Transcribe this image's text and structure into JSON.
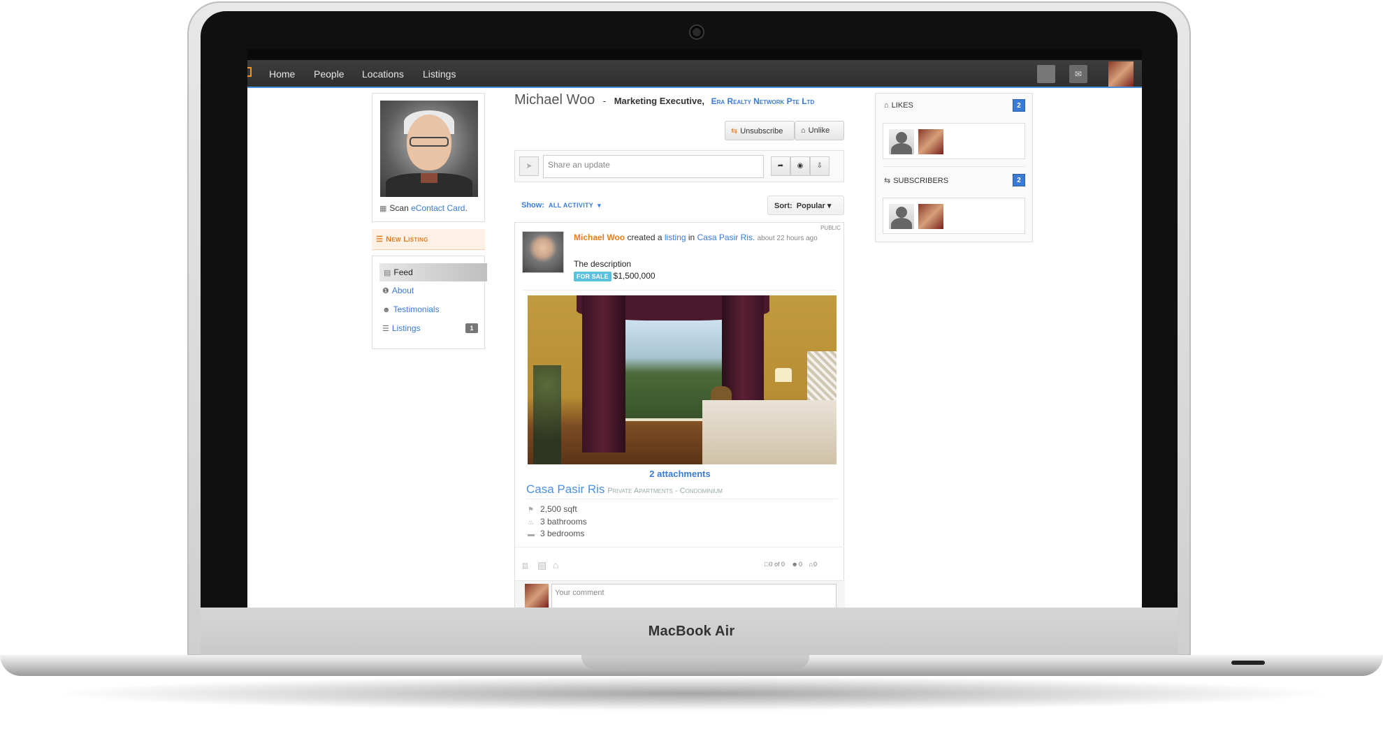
{
  "device": {
    "brand": "MacBook Air"
  },
  "nav": {
    "items": [
      {
        "label": "Home"
      },
      {
        "label": "People"
      },
      {
        "label": "Locations"
      },
      {
        "label": "Listings"
      }
    ],
    "mail_icon": "mail-icon"
  },
  "profile": {
    "name": "Michael Woo",
    "separator": "-",
    "role": "Marketing Executive,",
    "company": "Era Realty Network Pte Ltd",
    "scan_text": "Scan",
    "scan_link": "eContact Card",
    "scan_suffix": "."
  },
  "sidebar": {
    "new_listing": "New Listing",
    "items": [
      {
        "label": "Feed",
        "icon": "feed-icon"
      },
      {
        "label": "About",
        "icon": "info-icon"
      },
      {
        "label": "Testimonials",
        "icon": "users-icon"
      },
      {
        "label": "Listings",
        "icon": "list-icon",
        "count": "1"
      }
    ]
  },
  "actions": {
    "unsubscribe": "Unsubscribe",
    "unlike": "Unlike"
  },
  "share": {
    "placeholder": "Share an update"
  },
  "filters": {
    "show_label": "Show:",
    "show_value": "ALL ACTIVITY",
    "sort_label": "Sort:",
    "sort_value": "Popular"
  },
  "post": {
    "visibility": "PUBLIC",
    "author": "Michael Woo",
    "verb": "created a",
    "object": "listing",
    "prep": "in",
    "place": "Casa Pasir Ris.",
    "time": "about 22 hours ago",
    "description": "The description",
    "status": "FOR SALE",
    "price": "$1,500,000",
    "attachments": "2 attachments",
    "listing_title": "Casa Pasir Ris",
    "listing_subtitle": "Private Apartments - Condominium",
    "features": [
      {
        "text": "2,500 sqft",
        "icon": "area-icon"
      },
      {
        "text": "3 bathrooms",
        "icon": "bath-icon"
      },
      {
        "text": "3 bedrooms",
        "icon": "bed-icon"
      }
    ],
    "stats": {
      "comments": "0 of 0",
      "likes": "0",
      "shares": "0"
    },
    "comment_placeholder": "Your comment"
  },
  "right": {
    "likes_title": "LIKES",
    "likes_count": "2",
    "subscribers_title": "SUBSCRIBERS",
    "subscribers_count": "2"
  },
  "colors": {
    "accent": "#3a7bd5",
    "brand_orange": "#e67e22",
    "nav_bg": "#3d3d3d",
    "for_sale": "#5bc0de"
  }
}
